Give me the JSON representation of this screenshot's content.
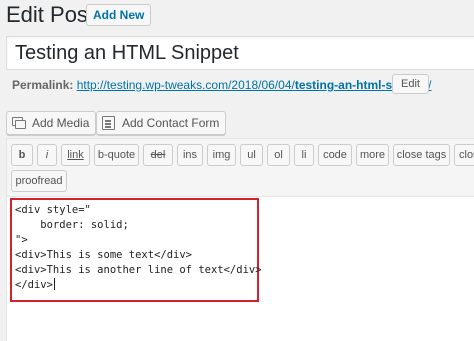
{
  "header": {
    "title": "Edit Post",
    "add_new_label": "Add New"
  },
  "post": {
    "title": "Testing an HTML Snippet"
  },
  "permalink": {
    "label": "Permalink:",
    "url_base": "http://testing.wp-tweaks.com/2018/06/04/",
    "slug": "testing-an-html-snippet",
    "url_tail": "/",
    "edit_label": "Edit"
  },
  "media_buttons": {
    "add_media_label": "Add Media",
    "add_contact_form_label": "Add Contact Form"
  },
  "quicktags": {
    "row1": [
      "b",
      "i",
      "link",
      "b-quote",
      "del",
      "ins",
      "img",
      "ul",
      "ol",
      "li",
      "code",
      "more",
      "close tags",
      "close"
    ],
    "row2": [
      "proofread"
    ]
  },
  "content": {
    "lines": [
      "<div style=\"",
      "    border: solid;",
      "\">",
      "<div>This is some text</div>",
      "<div>This is another line of text</div>",
      "</div>"
    ]
  },
  "colors": {
    "highlight_border": "#d6202a",
    "link": "#0073aa"
  }
}
